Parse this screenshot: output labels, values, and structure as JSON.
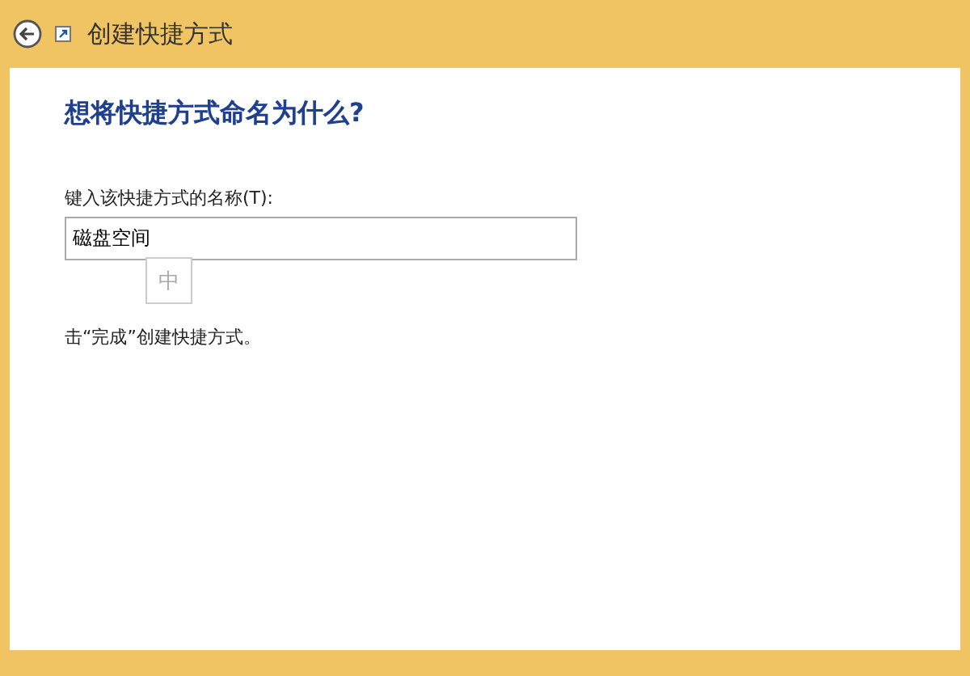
{
  "window": {
    "title": "创建快捷方式"
  },
  "heading": "想将快捷方式命名为什么?",
  "name_field": {
    "label": "键入该快捷方式的名称(T):",
    "value": "磁盘空间"
  },
  "ime_indicator": "中",
  "hint": "击“完成”创建快捷方式。"
}
